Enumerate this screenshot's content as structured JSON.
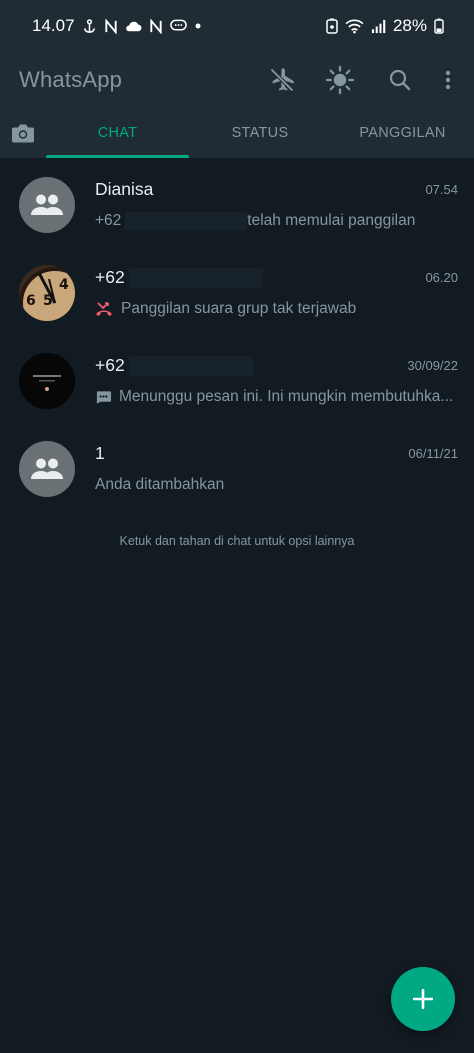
{
  "status_bar": {
    "time": "14.07",
    "battery": "28%",
    "left_icons": [
      "anchor-icon",
      "nfc-n-icon",
      "cloud-icon",
      "nfc-n-icon",
      "chat-bubble-icon",
      "dot-icon"
    ],
    "right_icons": [
      "lock-battery-icon",
      "wifi-icon",
      "signal-icon",
      "battery-icon"
    ]
  },
  "toolbar": {
    "title": "WhatsApp",
    "actions": [
      "airplane-off-icon",
      "brightness-icon",
      "search-icon",
      "more-vert-icon"
    ]
  },
  "tabs": {
    "camera_icon": "camera-icon",
    "items": [
      {
        "label": "CHAT",
        "active": true
      },
      {
        "label": "STATUS",
        "active": false
      },
      {
        "label": "PANGGILAN",
        "active": false
      }
    ]
  },
  "chats": [
    {
      "name": "Dianisa",
      "time": "07.54",
      "msg_prefix": "+62",
      "message": "telah memulai panggilan",
      "avatar": "group-icon"
    },
    {
      "name": "+62",
      "time": "06.20",
      "message": "Panggilan suara grup tak terjawab",
      "msg_icon": "missed-call-icon",
      "avatar": "clock-photo"
    },
    {
      "name": "+62",
      "time": "30/09/22",
      "message": "Menunggu pesan ini. Ini mungkin membutuhka...",
      "msg_icon": "message-waiting-icon",
      "avatar": "dark-photo"
    },
    {
      "name": "1",
      "time": "06/11/21",
      "message": "Anda ditambahkan",
      "avatar": "group-icon"
    }
  ],
  "hint": "Ketuk dan tahan di chat untuk opsi lainnya",
  "fab": {
    "icon": "plus-icon"
  },
  "colors": {
    "background": "#121b22",
    "header": "#1f2c34",
    "accent": "#00a884",
    "missed_call": "#f15c6d",
    "secondary_text": "#8696a0"
  }
}
